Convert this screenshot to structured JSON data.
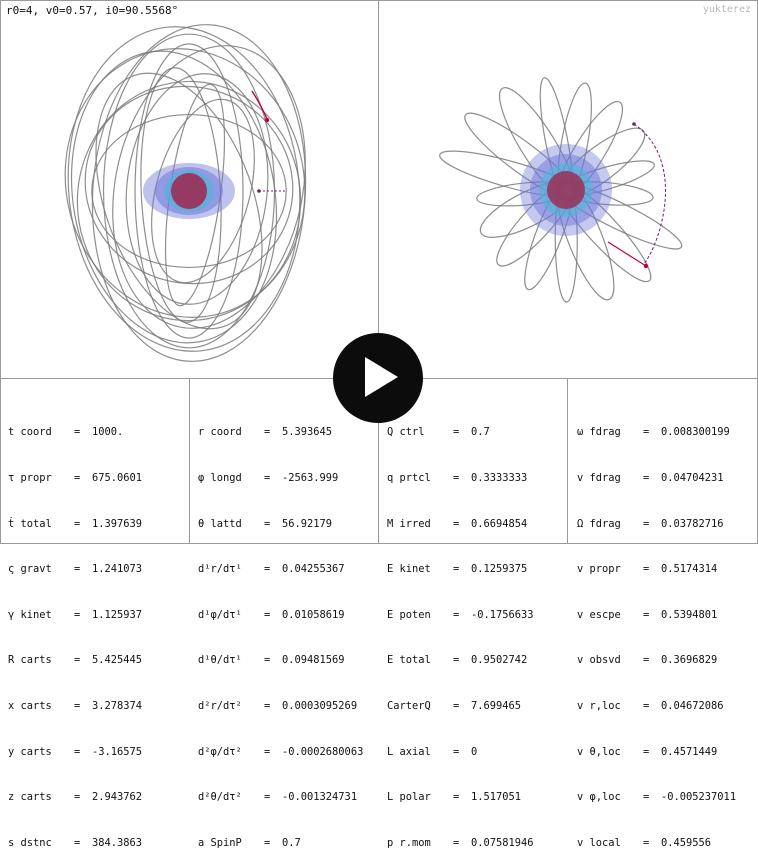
{
  "header": {
    "params": "r0=4, v0=0.57, i0=90.5568°",
    "watermark": "yukterez"
  },
  "columns": [
    [
      {
        "name": "t coord",
        "value": "1000."
      },
      {
        "name": "τ propr",
        "value": "675.0601"
      },
      {
        "name": "ṫ total",
        "value": "1.397639"
      },
      {
        "name": "ς gravt",
        "value": "1.241073"
      },
      {
        "name": "γ kinet",
        "value": "1.125937"
      },
      {
        "name": "R carts",
        "value": "5.425445"
      },
      {
        "name": "x carts",
        "value": "3.278374"
      },
      {
        "name": "y carts",
        "value": "-3.16575"
      },
      {
        "name": "z carts",
        "value": "2.943762"
      },
      {
        "name": "s dstnc",
        "value": "384.3863"
      }
    ],
    [
      {
        "name": "r coord",
        "value": "5.393645"
      },
      {
        "name": "φ longd",
        "value": "-2563.999"
      },
      {
        "name": "θ lattd",
        "value": "56.92179"
      },
      {
        "name": "d¹r/dτ¹",
        "value": "0.04255367"
      },
      {
        "name": "d¹φ/dτ¹",
        "value": "0.01058619"
      },
      {
        "name": "d¹θ/dτ¹",
        "value": "0.09481569"
      },
      {
        "name": "d²r/dτ²",
        "value": "0.0003095269"
      },
      {
        "name": "d²φ/dτ²",
        "value": "-0.0002680063"
      },
      {
        "name": "d²θ/dτ²",
        "value": "-0.001324731"
      },
      {
        "name": "a SpinP",
        "value": "0.7"
      }
    ],
    [
      {
        "name": "Q ctrl",
        "value": "0.7"
      },
      {
        "name": "q prtcl",
        "value": "0.3333333"
      },
      {
        "name": "M irred",
        "value": "0.6694854"
      },
      {
        "name": "E kinet",
        "value": "0.1259375"
      },
      {
        "name": "E poten",
        "value": "-0.1756633"
      },
      {
        "name": "E total",
        "value": "0.9502742"
      },
      {
        "name": "CarterQ",
        "value": "7.699465"
      },
      {
        "name": "L axial",
        "value": "0"
      },
      {
        "name": "L polar",
        "value": "1.517051"
      },
      {
        "name": "p r.mom",
        "value": "0.07581946"
      }
    ],
    [
      {
        "name": "ω fdrag",
        "value": "0.008300199"
      },
      {
        "name": "v fdrag",
        "value": "0.04704231"
      },
      {
        "name": "Ω fdrag",
        "value": "0.03782716"
      },
      {
        "name": "v propr",
        "value": "0.5174314"
      },
      {
        "name": "v escpe",
        "value": "0.5394801"
      },
      {
        "name": "v obsvd",
        "value": "0.3696829"
      },
      {
        "name": "v r,loc",
        "value": "0.04672086"
      },
      {
        "name": "v θ,loc",
        "value": "0.4571449"
      },
      {
        "name": "v φ,loc",
        "value": "-0.005237011"
      },
      {
        "name": "v local",
        "value": "0.459556"
      }
    ]
  ],
  "colors": {
    "orbit": "#7a7a7a",
    "particle": "#c0003a",
    "trail": "#7a1a6a",
    "horizon": "#9a2f55",
    "ergo_blue": "#6f78d8",
    "ergo_cyan": "#49b8d8",
    "play_button": "#0c0c0c"
  },
  "icons": {
    "play_button": "play-icon"
  }
}
